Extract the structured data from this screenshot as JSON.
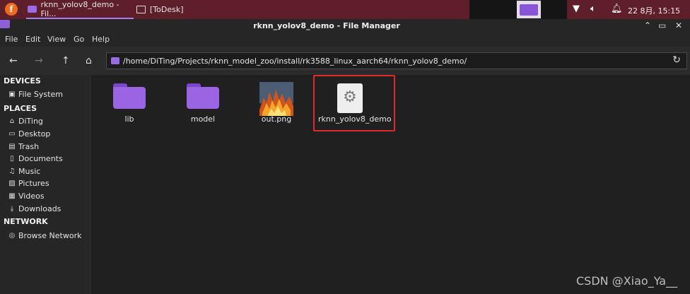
{
  "taskbar": {
    "tasks": [
      {
        "label": "rknn_yolov8_demo - Fil..."
      },
      {
        "label": "[ToDesk]"
      }
    ],
    "clock": "22 8月, 15:15"
  },
  "window": {
    "title": "rknn_yolov8_demo - File Manager",
    "menu": [
      "File",
      "Edit",
      "View",
      "Go",
      "Help"
    ]
  },
  "address": {
    "path": "/home/DiTing/Projects/rknn_model_zoo/install/rk3588_linux_aarch64/rknn_yolov8_demo/"
  },
  "sidebar": {
    "devices_header": "DEVICES",
    "devices": [
      {
        "label": "File System",
        "icon": "drive-icon"
      }
    ],
    "places_header": "PLACES",
    "places": [
      {
        "label": "DiTing",
        "icon": "home-icon"
      },
      {
        "label": "Desktop",
        "icon": "desktop-icon"
      },
      {
        "label": "Trash",
        "icon": "trash-icon"
      },
      {
        "label": "Documents",
        "icon": "documents-icon"
      },
      {
        "label": "Music",
        "icon": "music-icon"
      },
      {
        "label": "Pictures",
        "icon": "pictures-icon"
      },
      {
        "label": "Videos",
        "icon": "videos-icon"
      },
      {
        "label": "Downloads",
        "icon": "downloads-icon"
      }
    ],
    "network_header": "NETWORK",
    "network": [
      {
        "label": "Browse Network",
        "icon": "network-icon"
      }
    ]
  },
  "files": [
    {
      "name": "lib",
      "type": "folder"
    },
    {
      "name": "model",
      "type": "folder"
    },
    {
      "name": "out.png",
      "type": "image"
    },
    {
      "name": "rknn_yolov8_demo",
      "type": "executable",
      "highlighted": true
    }
  ],
  "colors": {
    "folder": "#9a64e3",
    "highlight": "#e22a2a",
    "taskbar": "#5e1f2a"
  },
  "watermark": "CSDN @Xiao_Ya__"
}
